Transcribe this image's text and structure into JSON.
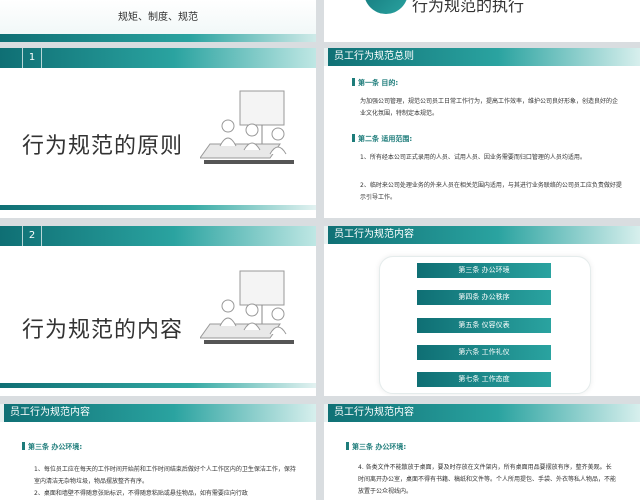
{
  "slide1": {
    "subtitle": "规矩、制度、规范"
  },
  "slide2": {
    "title": "行为规范的执行"
  },
  "slide3": {
    "number": "1",
    "title": "行为规范的原则"
  },
  "slide4": {
    "header": "员工行为规范总则",
    "sec1": "第一条  目的:",
    "para1": "为加强公司管理，规范公司员工日常工作行为，提高工作效率，维护公司良好形象，创造良好的企业文化氛围，特制定本规范。",
    "sec2": "第二条  适用范围:",
    "para2a": "1、所有经本公司正式录用的人员、试用人员、因业务需要而归口管理的人员均适用。",
    "para2b": "2、临时来公司处理业务的外来人员在相关范围内适用，与其进行业务联络的公司员工应负责做好提示引导工作。"
  },
  "slide5": {
    "number": "2",
    "title": "行为规范的内容"
  },
  "slide6": {
    "header": "员工行为规范内容",
    "items": [
      "第三条  办公环境",
      "第四条  办公秩序",
      "第五条  仪容仪表",
      "第六条  工作礼仪",
      "第七条  工作态度"
    ]
  },
  "slide7": {
    "header": "员工行为规范内容",
    "sec": "第三条  办公环境:",
    "para1": "1、每位员工应在每天的工作时间开始前和工作时间结束后做好个人工作区内的卫生保洁工作，保持室内清洁无杂物垃圾，物品摆放整齐有序。",
    "para2": "2、桌面和墙壁不得随意张贴标识，不得随意粘贴或悬挂物品，如有需要应向行政"
  },
  "slide8": {
    "header": "员工行为规范内容",
    "sec": "第三条  办公环境:",
    "para1": "4. 各类文件不能散放于桌面，要及时存放在文件架内，所有桌面用品要摆放有序，整齐美观。长时间离开办公室，桌面不得有书籍、稿纸和文件等。个人所用提包、手袋、外衣等私人物品，不能放置于公众视线内。"
  }
}
